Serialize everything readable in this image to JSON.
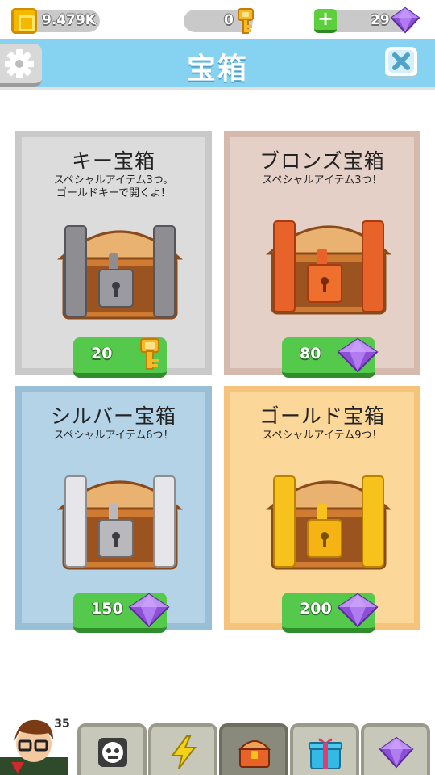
{
  "status": {
    "coins": "9.479K",
    "keys": "0",
    "gems": "29",
    "plus_label": "+"
  },
  "header": {
    "title": "宝箱"
  },
  "chests": [
    {
      "title": "キー宝箱",
      "desc_line1": "スペシャルアイテム3つ。",
      "desc_line2": "ゴールドキーで開くよ！",
      "price": "20",
      "currency": "key-icon"
    },
    {
      "title": "ブロンズ宝箱",
      "desc_line1": "スペシャルアイテム3つ！",
      "desc_line2": "",
      "price": "80",
      "currency": "gem-icon"
    },
    {
      "title": "シルバー宝箱",
      "desc_line1": "スペシャルアイテム6つ！",
      "desc_line2": "",
      "price": "150",
      "currency": "gem-icon"
    },
    {
      "title": "ゴールド宝箱",
      "desc_line1": "スペシャルアイテム9つ！",
      "desc_line2": "",
      "price": "200",
      "currency": "gem-icon"
    }
  ],
  "colors": {
    "header_bg": "#86d2f1",
    "buy_button": "#55c94b",
    "key_card": "#dcdcdc",
    "bronze_card": "#e4d0c6",
    "silver_card": "#b4d3e7",
    "gold_card": "#fbd799"
  },
  "bottom_nav": {
    "player_level": "35",
    "tabs": [
      "avatar",
      "character-icon",
      "lightning-icon",
      "chest-icon",
      "gift-icon",
      "gem-icon"
    ],
    "active_tab": "chest-icon"
  }
}
